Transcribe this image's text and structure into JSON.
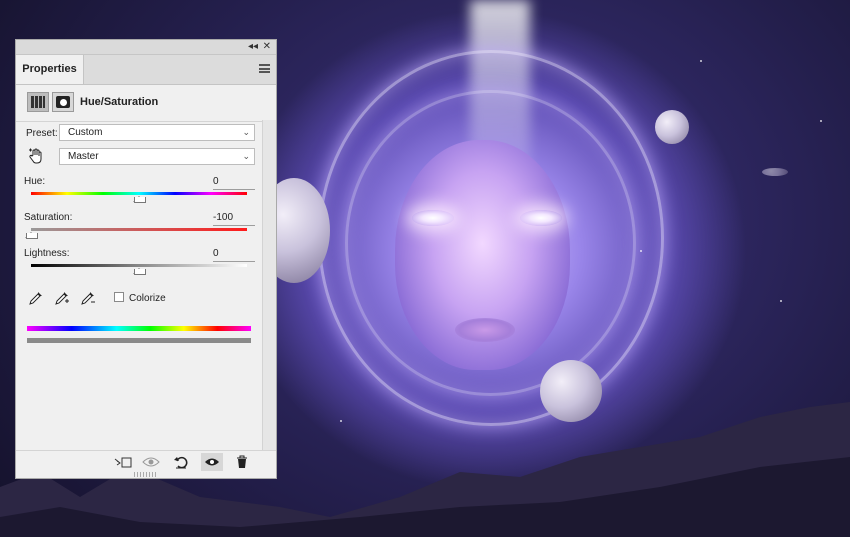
{
  "panel": {
    "collapse_glyph": "◂◂",
    "close_glyph": "✕",
    "tab_label": "Properties",
    "menu_icon": "panel-menu-icon",
    "adjustment_title": "Hue/Saturation",
    "header_icons": [
      "adjustment-layer-icon",
      "mask-icon"
    ]
  },
  "controls": {
    "preset_label": "Preset:",
    "preset_value": "Custom",
    "channel_value": "Master",
    "hand_tool_icon": "targeted-adjustment-hand-icon",
    "hue_label": "Hue:",
    "hue_value": "0",
    "hue_level": 0,
    "saturation_label": "Saturation:",
    "saturation_value": "-100",
    "saturation_level": -100,
    "lightness_label": "Lightness:",
    "lightness_value": "0",
    "lightness_level": 0,
    "eyedropper_icons": [
      "eyedropper-icon",
      "eyedropper-add-icon",
      "eyedropper-subtract-icon"
    ],
    "colorize_label": "Colorize",
    "colorize_checked": false
  },
  "footer": {
    "buttons": [
      "clip-to-layer-icon",
      "view-previous-state-icon",
      "reset-icon",
      "visibility-eye-icon",
      "trash-icon"
    ]
  },
  "colors": {
    "panel_bg": "#f0f0f0",
    "canvas_accent": "#9a86ea"
  }
}
